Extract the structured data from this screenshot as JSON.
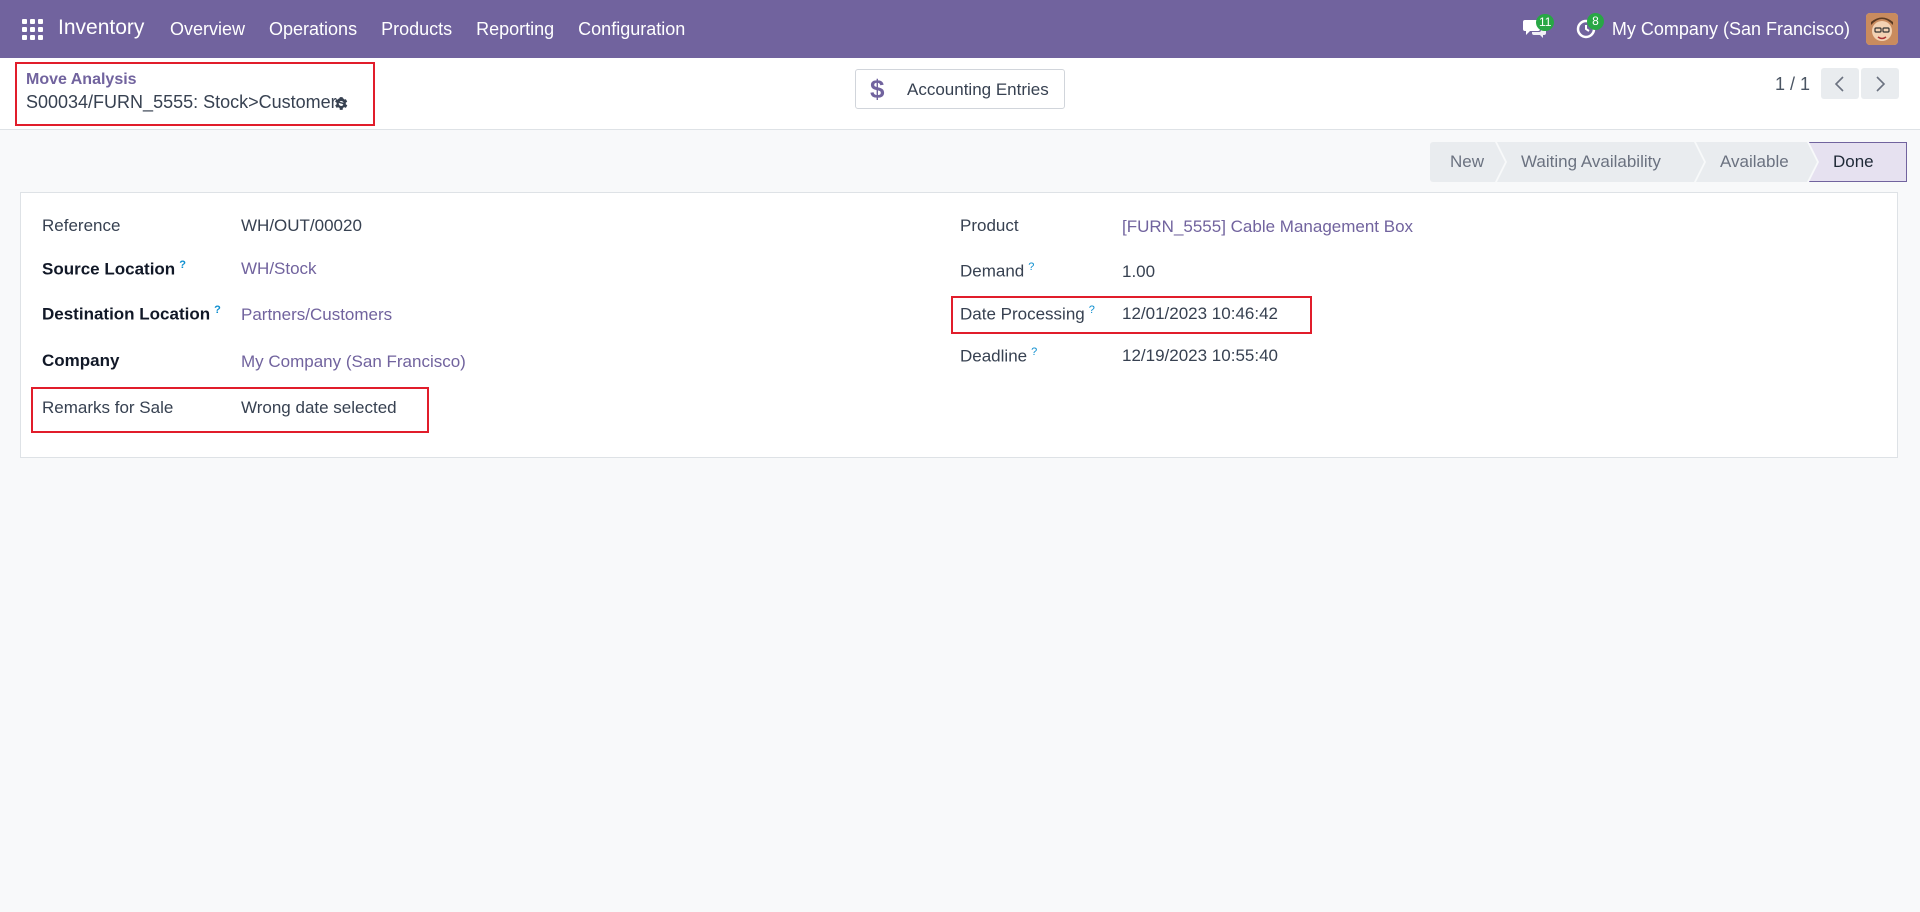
{
  "navbar": {
    "app_name": "Inventory",
    "menu": [
      "Overview",
      "Operations",
      "Products",
      "Reporting",
      "Configuration"
    ],
    "messages_count": "11",
    "activities_count": "8",
    "company": "My Company (San Francisco)",
    "accent_color": "#71639e",
    "badge_color": "#28a745"
  },
  "breadcrumb": {
    "parent": "Move Analysis",
    "current": "S00034/FURN_5555: Stock>Customers"
  },
  "smart_button": {
    "label": "Accounting Entries",
    "icon": "dollar-icon"
  },
  "pager": {
    "value": "1 / 1"
  },
  "status_bar": {
    "stages": [
      "New",
      "Waiting Availability",
      "Available",
      "Done"
    ],
    "active": "Done"
  },
  "form": {
    "left": {
      "reference_label": "Reference",
      "reference_value": "WH/OUT/00020",
      "source_label": "Source Location",
      "source_value": "WH/Stock",
      "destination_label": "Destination Location",
      "destination_value": "Partners/Customers",
      "company_label": "Company",
      "company_value": "My Company (San Francisco)",
      "remarks_label": "Remarks for Sale",
      "remarks_value": "Wrong date selected"
    },
    "right": {
      "product_label": "Product",
      "product_value": "[FURN_5555] Cable Management Box",
      "demand_label": "Demand",
      "demand_value": "1.00",
      "date_processing_label": "Date Processing",
      "date_processing_value": "12/01/2023 10:46:42",
      "deadline_label": "Deadline",
      "deadline_value": "12/19/2023 10:55:40"
    },
    "help_mark": "?"
  },
  "highlight_color": "#e11d2b"
}
